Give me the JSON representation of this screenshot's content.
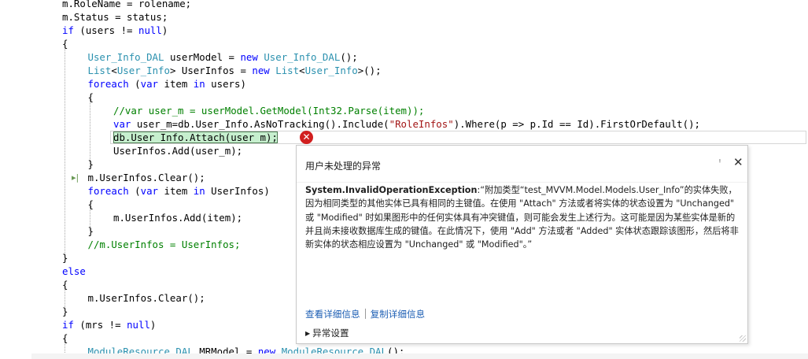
{
  "code_lines": [
    [
      {
        "t": "m.RoleName = rolename;",
        "c": ""
      }
    ],
    [
      {
        "t": "m.Status = status;",
        "c": ""
      }
    ],
    [
      {
        "t": "if",
        "c": "kw"
      },
      {
        "t": " (users != ",
        "c": ""
      },
      {
        "t": "null",
        "c": "kw"
      },
      {
        "t": ")",
        "c": ""
      }
    ],
    [
      {
        "t": "{",
        "c": ""
      }
    ],
    [
      {
        "t": "User_Info_DAL",
        "c": "ty"
      },
      {
        "t": " userModel = ",
        "c": ""
      },
      {
        "t": "new",
        "c": "kw"
      },
      {
        "t": " ",
        "c": ""
      },
      {
        "t": "User_Info_DAL",
        "c": "ty"
      },
      {
        "t": "();",
        "c": ""
      }
    ],
    [
      {
        "t": "List",
        "c": "ty"
      },
      {
        "t": "<",
        "c": ""
      },
      {
        "t": "User_Info",
        "c": "ty"
      },
      {
        "t": "> UserInfos = ",
        "c": ""
      },
      {
        "t": "new",
        "c": "kw"
      },
      {
        "t": " ",
        "c": ""
      },
      {
        "t": "List",
        "c": "ty"
      },
      {
        "t": "<",
        "c": ""
      },
      {
        "t": "User_Info",
        "c": "ty"
      },
      {
        "t": ">();",
        "c": ""
      }
    ],
    [
      {
        "t": "foreach",
        "c": "kw"
      },
      {
        "t": " (",
        "c": ""
      },
      {
        "t": "var",
        "c": "kw"
      },
      {
        "t": " item ",
        "c": ""
      },
      {
        "t": "in",
        "c": "kw"
      },
      {
        "t": " users)",
        "c": ""
      }
    ],
    [
      {
        "t": "{",
        "c": ""
      }
    ],
    [
      {
        "t": "//var user_m = userModel.GetModel(Int32.Parse(item));",
        "c": "cm"
      }
    ],
    [
      {
        "t": "var",
        "c": "kw"
      },
      {
        "t": " user_m=db.User_Info.AsNoTracking().Include(",
        "c": ""
      },
      {
        "t": "\"RoleInfos\"",
        "c": "st"
      },
      {
        "t": ").Where(p => p.Id == Id).FirstOrDefault();",
        "c": ""
      }
    ],
    [
      {
        "t": "db.User_Info.Attach(user_m);",
        "c": "highlight"
      }
    ],
    [
      {
        "t": "UserInfos.Add(user_m);",
        "c": ""
      }
    ],
    [
      {
        "t": "}",
        "c": ""
      }
    ],
    [
      {
        "t": "m.UserInfos.Clear();",
        "c": ""
      }
    ],
    [
      {
        "t": "foreach",
        "c": "kw"
      },
      {
        "t": " (",
        "c": ""
      },
      {
        "t": "var",
        "c": "kw"
      },
      {
        "t": " item ",
        "c": ""
      },
      {
        "t": "in",
        "c": "kw"
      },
      {
        "t": " UserInfos)",
        "c": ""
      }
    ],
    [
      {
        "t": "{",
        "c": ""
      }
    ],
    [
      {
        "t": "m.UserInfos.Add(item);",
        "c": ""
      }
    ],
    [
      {
        "t": "}",
        "c": ""
      }
    ],
    [
      {
        "t": "//m.UserInfos = UserInfos;",
        "c": "cm"
      }
    ],
    [
      {
        "t": "}",
        "c": ""
      }
    ],
    [
      {
        "t": "else",
        "c": "kw"
      }
    ],
    [
      {
        "t": "{",
        "c": ""
      }
    ],
    [
      {
        "t": "m.UserInfos.Clear();",
        "c": ""
      }
    ],
    [
      {
        "t": "}",
        "c": ""
      }
    ],
    [
      {
        "t": "if",
        "c": "kw"
      },
      {
        "t": " (mrs != ",
        "c": ""
      },
      {
        "t": "null",
        "c": "kw"
      },
      {
        "t": ")",
        "c": ""
      }
    ],
    [
      {
        "t": "{",
        "c": ""
      }
    ],
    [
      {
        "t": "ModuleResource_DAL",
        "c": "ty"
      },
      {
        "t": " MRModel = ",
        "c": ""
      },
      {
        "t": "new",
        "c": "kw"
      },
      {
        "t": " ",
        "c": ""
      },
      {
        "t": "ModuleResource_DAL",
        "c": "ty"
      },
      {
        "t": "();",
        "c": ""
      }
    ]
  ],
  "indent_levels": [
    0,
    0,
    0,
    0,
    1,
    1,
    1,
    1,
    2,
    2,
    2,
    2,
    1,
    1,
    1,
    1,
    2,
    1,
    1,
    0,
    0,
    0,
    1,
    0,
    0,
    0,
    1
  ],
  "exception": {
    "title": "用户未处理的异常",
    "pin_icon": "pin-icon",
    "close_icon": "close-icon",
    "type": "System.InvalidOperationException",
    "message": ":“附加类型“test_MVVM.Model.Models.User_Info”的实体失败，因为相同类型的其他实体已具有相同的主键值。在使用 \"Attach\" 方法或者将实体的状态设置为 \"Unchanged\" 或 \"Modified\" 时如果图形中的任何实体具有冲突键值，则可能会发生上述行为。这可能是因为某些实体是新的并且尚未接收数据库生成的键值。在此情况下，使用 \"Add\" 方法或者 \"Added\" 实体状态跟踪该图形，然后将非新实体的状态相应设置为 \"Unchanged\" 或 \"Modified\"。”",
    "view_details": "查看详细信息",
    "copy_details": "复制详细信息",
    "settings": "异常设置"
  },
  "error_glyph": "✕",
  "next_statement_glyph": "▸|",
  "colors": {
    "keyword": "#0000ff",
    "type": "#2b91af",
    "string": "#a31515",
    "comment": "#008000",
    "error": "#d11f1f",
    "link": "#1e5fb4",
    "highlight": "#c6efce"
  }
}
